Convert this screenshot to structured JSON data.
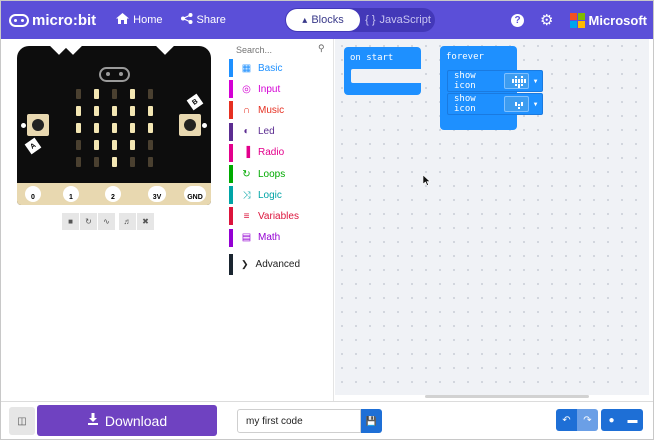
{
  "header": {
    "logo_text": "micro:bit",
    "home_label": "Home",
    "share_label": "Share",
    "blocks_label": "Blocks",
    "javascript_label": "JavaScript",
    "brand_text": "Microsoft",
    "brand_colors": [
      "#f25022",
      "#7fba00",
      "#00a4ef",
      "#ffb900"
    ],
    "accent": "#5b4fd8"
  },
  "simulator": {
    "pin_labels": [
      "0",
      "1",
      "2",
      "3V",
      "GND"
    ],
    "button_a": "A",
    "button_b": "B",
    "controls": [
      "stop-icon",
      "restart-icon",
      "slow-motion-icon",
      "mute-icon",
      "fullscreen-icon"
    ]
  },
  "toolbox": {
    "search_placeholder": "Search...",
    "categories": [
      {
        "label": "Basic",
        "color": "#1e90ff",
        "icon": "grid-icon"
      },
      {
        "label": "Input",
        "color": "#d400d4",
        "icon": "target-icon"
      },
      {
        "label": "Music",
        "color": "#e63022",
        "icon": "headphones-icon"
      },
      {
        "label": "Led",
        "color": "#5c2d91",
        "icon": "toggle-icon"
      },
      {
        "label": "Radio",
        "color": "#e3008c",
        "icon": "signal-icon"
      },
      {
        "label": "Loops",
        "color": "#00aa00",
        "icon": "loop-icon"
      },
      {
        "label": "Logic",
        "color": "#00a4a6",
        "icon": "shuffle-icon"
      },
      {
        "label": "Variables",
        "color": "#dc143c",
        "icon": "lines-icon"
      },
      {
        "label": "Math",
        "color": "#9400d3",
        "icon": "calculator-icon"
      }
    ],
    "advanced_label": "Advanced"
  },
  "workspace": {
    "on_start_label": "on start",
    "forever_label": "forever",
    "show_icon_label_1": "show icon",
    "show_icon_label_2": "show icon"
  },
  "bottom": {
    "download_label": "Download",
    "project_name": "my first code",
    "download_color": "#6f42c1"
  }
}
